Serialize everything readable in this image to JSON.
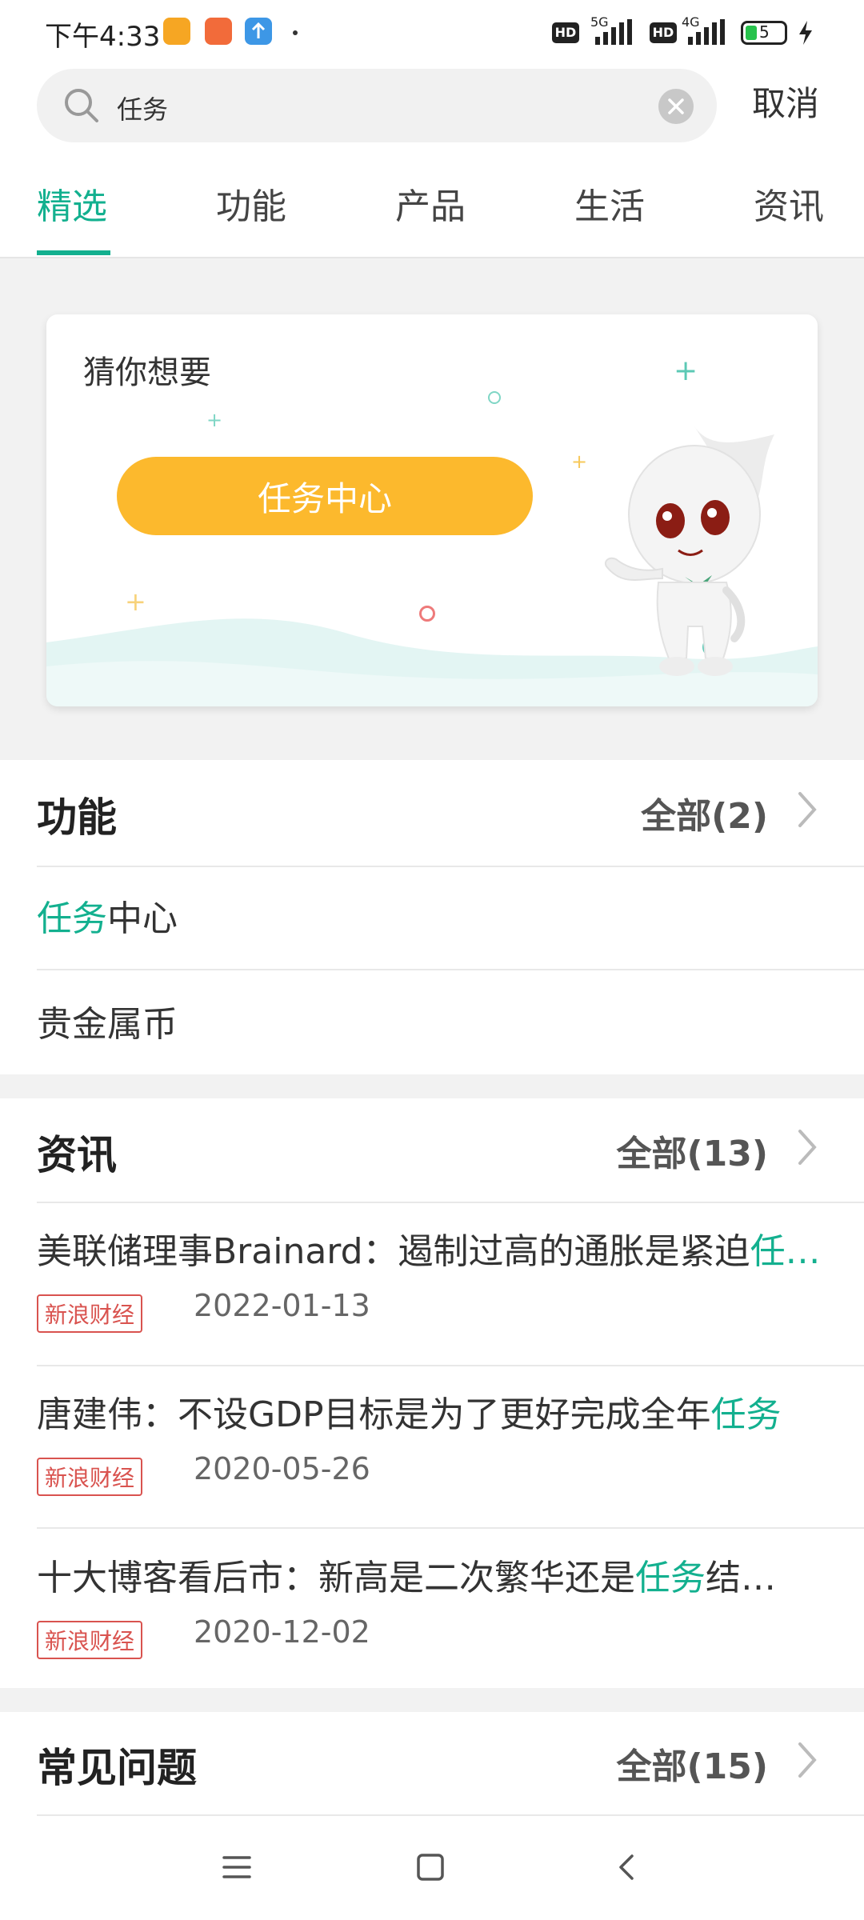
{
  "status_bar": {
    "time": "下午4:33",
    "network_5g": "5G",
    "network_4g": "4G",
    "hd": "HD",
    "battery": "5"
  },
  "search": {
    "value": "任务",
    "cancel_label": "取消"
  },
  "tabs": [
    {
      "label": "精选",
      "active": true
    },
    {
      "label": "功能"
    },
    {
      "label": "产品"
    },
    {
      "label": "生活"
    },
    {
      "label": "资讯"
    }
  ],
  "promo": {
    "title": "猜你想要",
    "button_label": "任务中心"
  },
  "functions": {
    "title": "功能",
    "more_label": "全部(2)",
    "items": [
      {
        "highlight": "任务",
        "rest": "中心"
      },
      {
        "highlight": "",
        "rest": "贵金属币"
      }
    ]
  },
  "news": {
    "title": "资讯",
    "more_label": "全部(13)",
    "items": [
      {
        "prefix": "美联储理事Brainard：遏制过高的通胀是紧迫",
        "highlight": "任…",
        "suffix": "",
        "source": "新浪财经",
        "date": "2022-01-13"
      },
      {
        "prefix": "唐建伟：不设GDP目标是为了更好完成全年",
        "highlight": "任务",
        "suffix": "",
        "source": "新浪财经",
        "date": "2020-05-26"
      },
      {
        "prefix": "十大博客看后市：新高是二次繁华还是",
        "highlight": "任务",
        "suffix": "结…",
        "source": "新浪财经",
        "date": "2020-12-02"
      }
    ]
  },
  "faq": {
    "title": "常见问题",
    "more_label": "全部(15)"
  },
  "colors": {
    "accent": "#13b08f",
    "promo_button": "#fcb92d",
    "badge": "#d9534f"
  }
}
